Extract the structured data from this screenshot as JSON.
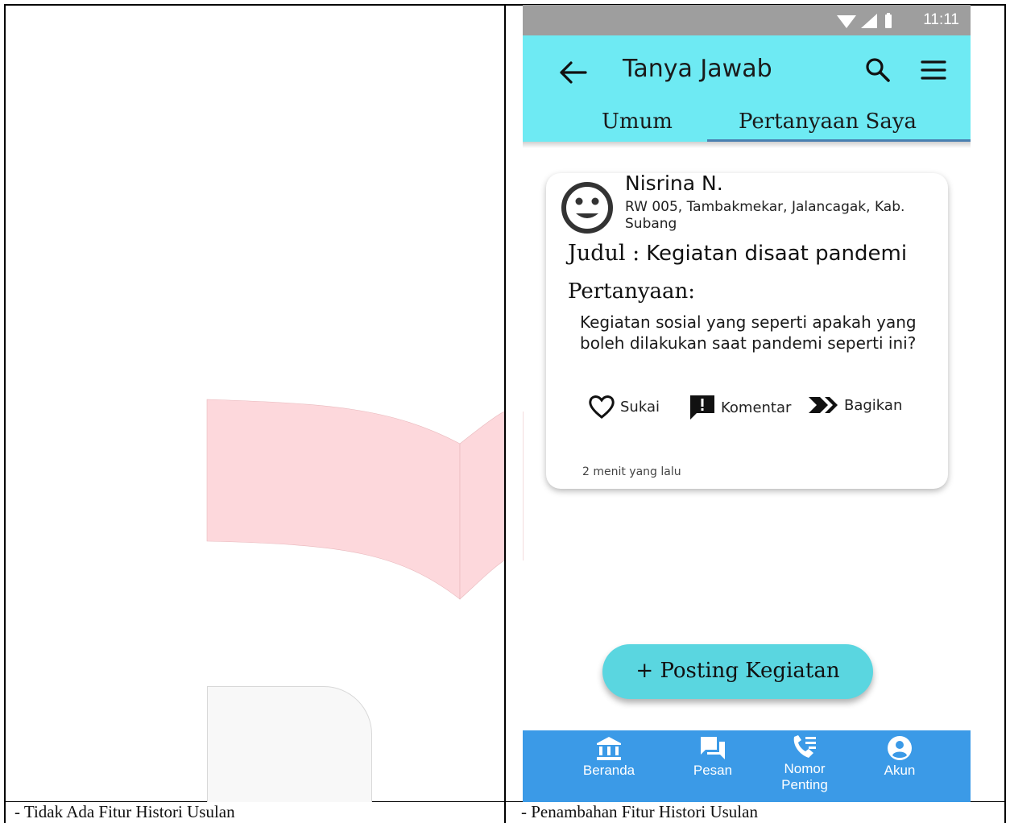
{
  "captions": {
    "left": "- Tidak Ada Fitur Histori Usulan",
    "right": "- Penambahan Fitur Histori Usulan"
  },
  "status_bar": {
    "time": "11:11",
    "icons": [
      "wifi-icon",
      "signal-icon",
      "battery-icon"
    ]
  },
  "app_bar": {
    "title": "Tanya Jawab",
    "tabs": [
      {
        "label": "Umum",
        "selected": false
      },
      {
        "label": "Pertanyaan Saya",
        "selected": true
      }
    ]
  },
  "post": {
    "user_name": "Nisrina N.",
    "location": "RW 005, Tambakmekar, Jalancagak, Kab. Subang",
    "judul_label": "Judul :",
    "judul_value": "Kegiatan disaat pandemi",
    "pertanyaan_label": "Pertanyaan:",
    "pertanyaan_text": "Kegiatan sosial yang seperti apakah yang boleh dilakukan saat pandemi seperti ini?",
    "actions": {
      "like": "Sukai",
      "comment": "Komentar",
      "share": "Bagikan"
    },
    "timestamp": "2 menit yang lalu"
  },
  "fab_label": "+ Posting Kegiatan",
  "bottom_nav": [
    {
      "label": "Beranda",
      "icon": "bank-icon"
    },
    {
      "label": "Pesan",
      "icon": "chat-icon"
    },
    {
      "label": "Nomor Penting",
      "icon": "phone-book-icon"
    },
    {
      "label": "Akun",
      "icon": "account-icon"
    }
  ],
  "colors": {
    "app_bar": "#6eeaf3",
    "fab": "#5ad6e0",
    "bottom_nav": "#3b9ae7",
    "status_bar": "#9e9e9e"
  }
}
